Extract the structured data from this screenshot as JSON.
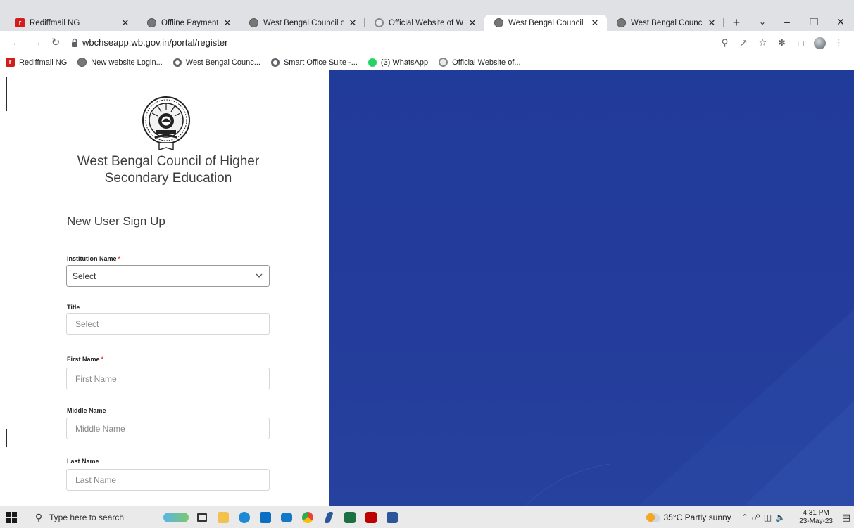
{
  "browser": {
    "tabs": [
      {
        "label": "Rediffmail NG",
        "icon": "rediffmail-icon",
        "active": false
      },
      {
        "label": "Offline Payment",
        "icon": "council-icon",
        "active": false
      },
      {
        "label": "West Bengal Council of High·",
        "icon": "council-icon",
        "active": false
      },
      {
        "label": "Official Website of West Beng",
        "icon": "official-website-icon",
        "active": false
      },
      {
        "label": "West Bengal Council of High·",
        "icon": "council-icon",
        "active": true
      },
      {
        "label": "West Bengal Council of High·",
        "icon": "council-icon",
        "active": false
      }
    ],
    "new_tab_label": "+",
    "tab_close": "✕",
    "url": "wbchseapp.wb.gov.in/portal/register",
    "bookmarks": [
      {
        "label": "Rediffmail NG",
        "icon": "rediffmail-icon"
      },
      {
        "label": "New website Login...",
        "icon": "council-icon"
      },
      {
        "label": "West Bengal Counc...",
        "icon": "globe-icon"
      },
      {
        "label": "Smart Office Suite -...",
        "icon": "globe-icon"
      },
      {
        "label": "(3) WhatsApp",
        "icon": "whatsapp-icon"
      },
      {
        "label": "Official Website of...",
        "icon": "official-website-icon"
      }
    ]
  },
  "page": {
    "org_line1": "West Bengal Council of Higher",
    "org_line2": "Secondary Education",
    "signup_title": "New User Sign Up",
    "fields": {
      "institution": {
        "label": "Institution Name",
        "required": "*",
        "value": "Select"
      },
      "title": {
        "label": "Title",
        "placeholder": "Select"
      },
      "first_name": {
        "label": "First Name",
        "required": "*",
        "placeholder": "First Name"
      },
      "middle_name": {
        "label": "Middle Name",
        "placeholder": "Middle Name"
      },
      "last_name": {
        "label": "Last Name",
        "placeholder": "Last Name"
      }
    },
    "accent_color": "#233d9c"
  },
  "taskbar": {
    "search_placeholder": "Type here to search",
    "weather": "35°C  Partly sunny",
    "time": "4:31 PM",
    "date": "23-May-23"
  }
}
